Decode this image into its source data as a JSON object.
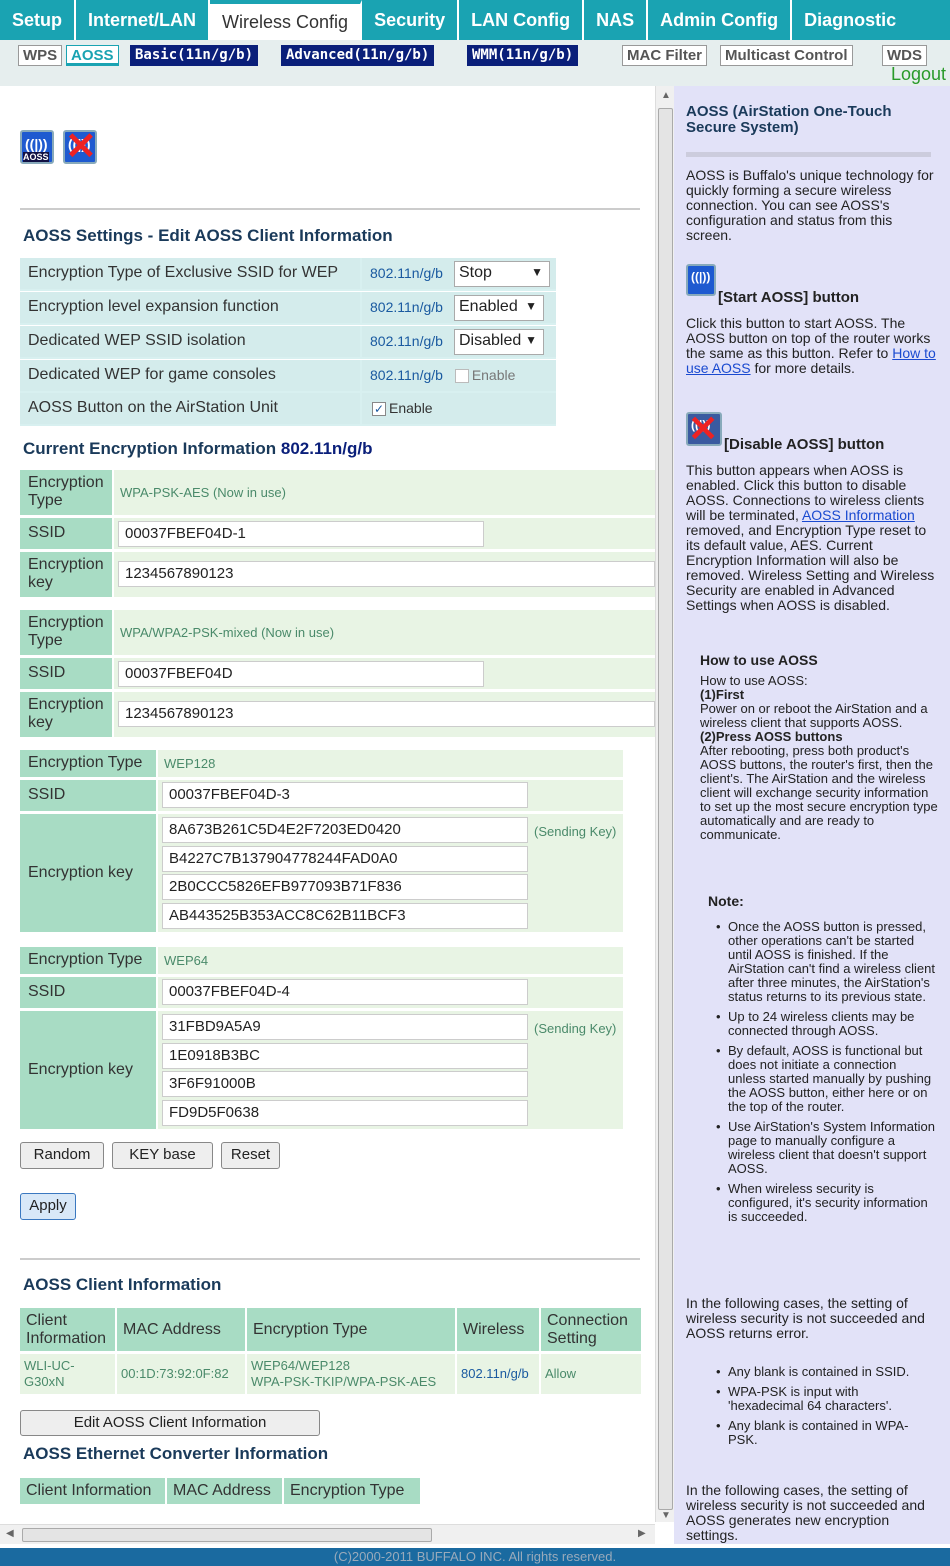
{
  "nav": {
    "tabs": [
      "Setup",
      "Internet/LAN",
      "Wireless Config",
      "Security",
      "LAN Config",
      "NAS",
      "Admin Config",
      "Diagnostic"
    ],
    "active": "Wireless Config",
    "subtabs": [
      "WPS",
      "AOSS",
      "Basic(11n/g/b)",
      "Advanced(11n/g/b)",
      "WMM(11n/g/b)",
      "MAC Filter",
      "Multicast Control",
      "WDS"
    ],
    "logout": "Logout"
  },
  "icons": {
    "aoss": "aoss-icon",
    "aoss_label": "AOSS",
    "disable": "disable-aoss-icon"
  },
  "settings": {
    "title": "AOSS Settings - Edit AOSS Client Information",
    "rows": [
      {
        "label": "Encryption Type of Exclusive SSID for WEP",
        "mode": "802.11n/g/b",
        "value": "Stop"
      },
      {
        "label": "Encryption level expansion function",
        "mode": "802.11n/g/b",
        "value": "Enabled"
      },
      {
        "label": "Dedicated WEP SSID isolation",
        "mode": "802.11n/g/b",
        "value": "Disabled"
      },
      {
        "label": "Dedicated WEP for game consoles",
        "mode": "802.11n/g/b",
        "value": "Enable"
      },
      {
        "label": "AOSS Button on the AirStation Unit",
        "value": "Enable"
      }
    ]
  },
  "current": {
    "title": "Current Encryption Information",
    "mode": "802.11n/g/b",
    "labels": {
      "enc_type": "Encryption Type",
      "enc_type_l1": "Encryption",
      "enc_type_l2": "Type",
      "ssid": "SSID",
      "key_l1": "Encryption",
      "key_l2": "key",
      "key": "Encryption key"
    },
    "wpa1": {
      "type": "WPA-PSK-AES (Now in use)",
      "ssid": "00037FBEF04D-1",
      "key": "1234567890123"
    },
    "wpa2": {
      "type": "WPA/WPA2-PSK-mixed (Now in use)",
      "ssid": "00037FBEF04D",
      "key": "1234567890123"
    },
    "wep128": {
      "type": "WEP128",
      "ssid": "00037FBEF04D-3",
      "keys": [
        "8A673B261C5D4E2F7203ED0420",
        "B4227C7B137904778244FAD0A0",
        "2B0CCC5826EFB977093B71F836",
        "AB443525B353ACC8C62B11BCF3"
      ],
      "sending": "(Sending Key)"
    },
    "wep64": {
      "type": "WEP64",
      "ssid": "00037FBEF04D-4",
      "keys": [
        "31FBD9A5A9",
        "1E0918B3BC",
        "3F6F91000B",
        "FD9D5F0638"
      ],
      "sending": "(Sending Key)"
    }
  },
  "buttons": {
    "random": "Random",
    "keybase": "KEY base",
    "reset": "Reset",
    "apply": "Apply",
    "edit": "Edit AOSS Client Information"
  },
  "client": {
    "title": "AOSS Client Information",
    "headers": {
      "client_l1": "Client",
      "client_l2": "Information",
      "mac": "MAC Address",
      "enc": "Encryption Type",
      "wireless": "Wireless",
      "conn_l1": "Connection",
      "conn_l2": "Setting"
    },
    "row": {
      "client_l1": "WLI-UC-",
      "client_l2": "G30xN",
      "mac": "00:1D:73:92:0F:82",
      "enc_l1": "WEP64/WEP128",
      "enc_l2": "WPA-PSK-TKIP/WPA-PSK-AES",
      "wireless": "802.11n/g/b",
      "conn": "Allow"
    }
  },
  "ethernet": {
    "title": "AOSS Ethernet Converter Information",
    "headers": [
      "Client Information",
      "MAC Address",
      "Encryption Type"
    ]
  },
  "help": {
    "title_l1": "AOSS (AirStation One-Touch",
    "title_l2": "Secure System)",
    "intro": "AOSS is Buffalo's unique technology for quickly forming a secure wireless connection. You can see AOSS's configuration and status from this screen.",
    "start_title": "[Start AOSS] button",
    "start_text": "Click this button to start AOSS. The AOSS button on top of the router works the same as this button. Refer to",
    "start_link": "How to use AOSS",
    "start_tail": "for more details.",
    "disable_title": "[Disable AOSS] button",
    "disable_text1": "This button appears when AOSS is enabled. Click this button to disable AOSS. Connections to wireless clients will be terminated,",
    "disable_link": "AOSS Information",
    "disable_text2": "removed, and Encryption Type reset to its default value, AES. Current Encryption Information will also be removed. Wireless Setting and Wireless Security are enabled in Advanced Settings when AOSS is disabled.",
    "howto_title": "How to use AOSS",
    "howto_intro": "How to use AOSS:",
    "step1_title": "(1)First",
    "step1": "Power on or reboot the AirStation and a wireless client that supports AOSS.",
    "step2_title": "(2)Press AOSS buttons",
    "step2": "After rebooting, press both product's AOSS buttons, the router's first, then the client's. The AirStation and the wireless client will exchange security information to set up the most secure encryption type automatically and are ready to communicate.",
    "note_title": "Note:",
    "notes": [
      "Once the AOSS button is pressed, other operations can't be started until AOSS is finished. If the AirStation can't find a wireless client after three minutes, the AirStation's status returns to its previous state.",
      "Up to 24 wireless clients may be connected through AOSS.",
      "By default, AOSS is functional but does not initiate a connection unless started manually by pushing the AOSS button, either here or on the top of the router.",
      "Use AirStation's System Information page to manually configure a wireless client that doesn't support AOSS.",
      "When wireless security is configured, it's security information is succeeded."
    ],
    "cases1": "In the following cases, the setting of wireless security is not succeeded and AOSS returns error.",
    "cases1_list": [
      "Any blank is contained in SSID.",
      "WPA-PSK is input with 'hexadecimal 64 characters'.",
      "Any blank is contained in WPA-PSK."
    ],
    "cases2": "In the following cases, the setting of wireless security is not succeeded and AOSS generates new encryption settings."
  },
  "footer": "(C)2000-2011 BUFFALO INC. All rights reserved.",
  "colors": {
    "nav": "#1aa3b2",
    "label_cell": "#a8dcc4",
    "value_cell": "#e8f4e4",
    "help_bg": "#e2e2f8"
  }
}
